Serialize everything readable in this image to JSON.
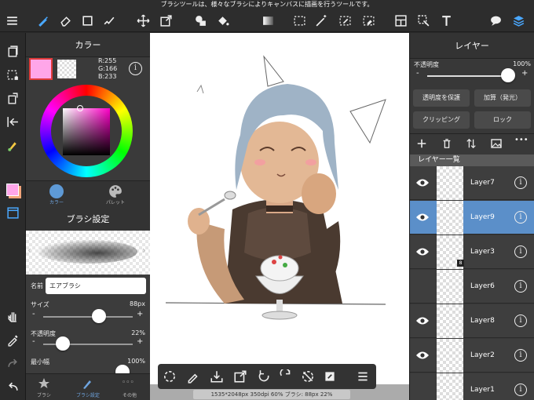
{
  "status_hint": "ブラシツールは、様々なブラシによりキャンバスに描画を行うツールです。",
  "color_panel": {
    "title": "カラー",
    "r": "R:255",
    "g": "G:166",
    "b": "B:233",
    "tab_color": "カラー",
    "tab_palette": "パレット",
    "primary_color": "#ffa6e9"
  },
  "brush_panel": {
    "title": "ブラシ設定",
    "name_label": "名前",
    "name_value": "エアブラシ",
    "size_label": "サイズ",
    "size_value": "88px",
    "size_fraction": 0.62,
    "opacity_label": "不透明度",
    "opacity_value": "22%",
    "opacity_fraction": 0.22,
    "minwidth_label": "最小幅",
    "minwidth_value": "100%",
    "tabs": [
      "ブラシ",
      "ブラシ設定",
      "その他"
    ]
  },
  "layer_panel": {
    "title": "レイヤー",
    "opacity_label": "不透明度",
    "opacity_value": "100%",
    "protect_button": "透明度を保護",
    "blend_button": "加算（発光）",
    "clipping_button": "クリッピング",
    "lock_button": "ロック",
    "list_title": "レイヤー一覧",
    "layers": [
      {
        "name": "Layer7",
        "visible": true,
        "selected": false
      },
      {
        "name": "Layer9",
        "visible": true,
        "selected": true
      },
      {
        "name": "Layer3",
        "visible": true,
        "selected": false,
        "badge": "8"
      },
      {
        "name": "Layer6",
        "visible": false,
        "selected": false
      },
      {
        "name": "Layer8",
        "visible": true,
        "selected": false
      },
      {
        "name": "Layer2",
        "visible": true,
        "selected": false
      },
      {
        "name": "Layer1",
        "visible": false,
        "selected": false
      }
    ]
  },
  "canvas_status": "1535*2048px 350dpi 60% ブラシ: 88px 22%"
}
